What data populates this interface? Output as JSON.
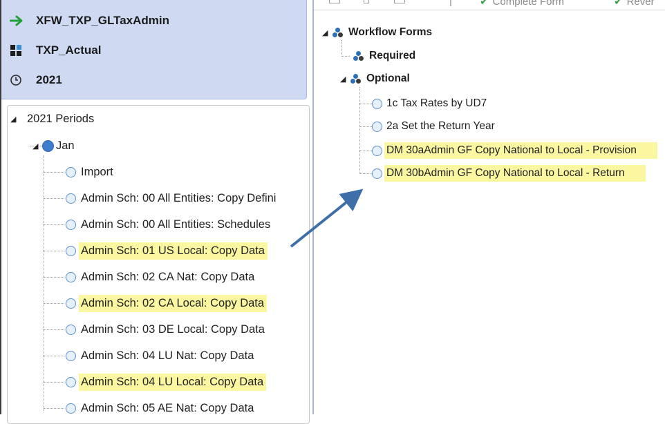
{
  "pov": {
    "workflow": "XFW_TXP_GLTaxAdmin",
    "scenario": "TXP_Actual",
    "time": "2021"
  },
  "left_tree": {
    "root": "2021 Periods",
    "period": "Jan",
    "items": [
      {
        "label": "Import",
        "highlighted": false
      },
      {
        "label": "Admin Sch: 00 All Entities: Copy Defini",
        "highlighted": false
      },
      {
        "label": "Admin Sch: 00 All Entities: Schedules",
        "highlighted": false
      },
      {
        "label": "Admin Sch: 01 US Local: Copy Data",
        "highlighted": true
      },
      {
        "label": "Admin Sch: 02 CA Nat: Copy Data",
        "highlighted": false
      },
      {
        "label": "Admin Sch: 02 CA Local: Copy Data",
        "highlighted": true
      },
      {
        "label": "Admin Sch: 03 DE Local: Copy Data",
        "highlighted": false
      },
      {
        "label": "Admin Sch: 04 LU Nat: Copy Data",
        "highlighted": false
      },
      {
        "label": "Admin Sch: 04 LU Local: Copy Data",
        "highlighted": true
      },
      {
        "label": "Admin Sch: 05 AE Nat: Copy Data",
        "highlighted": false
      }
    ]
  },
  "toolbar": {
    "complete_form": "Complete Form",
    "revert": "Rever"
  },
  "right_tree": {
    "root": "Workflow Forms",
    "required": "Required",
    "optional": "Optional",
    "items": [
      {
        "label": "1c Tax Rates by UD7",
        "highlighted": false
      },
      {
        "label": "2a Set the Return Year",
        "highlighted": false
      },
      {
        "label": "DM 30aAdmin GF Copy National to Local - Provision",
        "highlighted": true
      },
      {
        "label": "DM 30bAdmin GF Copy National to Local - Return",
        "highlighted": true
      }
    ]
  },
  "colors": {
    "highlight": "#fbf7a0",
    "pov_background": "#cfdaf2",
    "arrow": "#3f6fa8",
    "node_circle": "#5b8fcf"
  },
  "icons": {
    "workflow": "green-right-arrow-icon",
    "scenario": "scenario-blocks-icon",
    "time": "clock-icon",
    "workflow_form_group": "workflow-group-dots-icon"
  }
}
